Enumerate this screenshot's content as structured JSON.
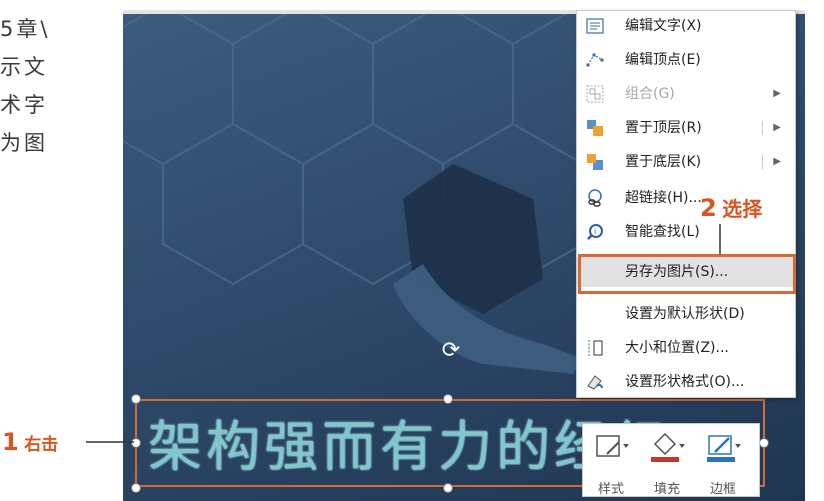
{
  "side_text": {
    "lines": [
      "5章\\",
      "示文",
      "术字",
      "为图"
    ]
  },
  "wordart": {
    "text": "架构强而有力的经纪"
  },
  "context_menu": {
    "items": [
      {
        "label": "编辑文字(X)",
        "icon": "edit-text-icon"
      },
      {
        "label": "编辑顶点(E)",
        "icon": "edit-points-icon"
      },
      {
        "label": "组合(G)",
        "icon": "group-icon",
        "disabled": true,
        "submenu": true
      },
      {
        "label": "置于顶层(R)",
        "icon": "bring-to-front-icon",
        "submenu": true
      },
      {
        "label": "置于底层(K)",
        "icon": "send-to-back-icon",
        "submenu": true
      },
      {
        "label": "超链接(H)...",
        "icon": "hyperlink-icon"
      },
      {
        "label": "智能查找(L)",
        "icon": "smart-lookup-icon"
      },
      {
        "label": "另存为图片(S)...",
        "highlighted": true
      },
      {
        "label": "设置为默认形状(D)"
      },
      {
        "label": "大小和位置(Z)...",
        "icon": "size-position-icon"
      },
      {
        "label": "设置形状格式(O)...",
        "icon": "format-shape-icon"
      }
    ]
  },
  "mini_toolbar": {
    "style_label": "样式",
    "fill_label": "填充",
    "outline_label": "边框",
    "fill_color": "#c0392b",
    "outline_color": "#2e75b6"
  },
  "annotations": {
    "step1_num": "1",
    "step1_text": "右击",
    "step2_num": "2",
    "step2_text": "选择",
    "accent_color": "#d9541e"
  }
}
